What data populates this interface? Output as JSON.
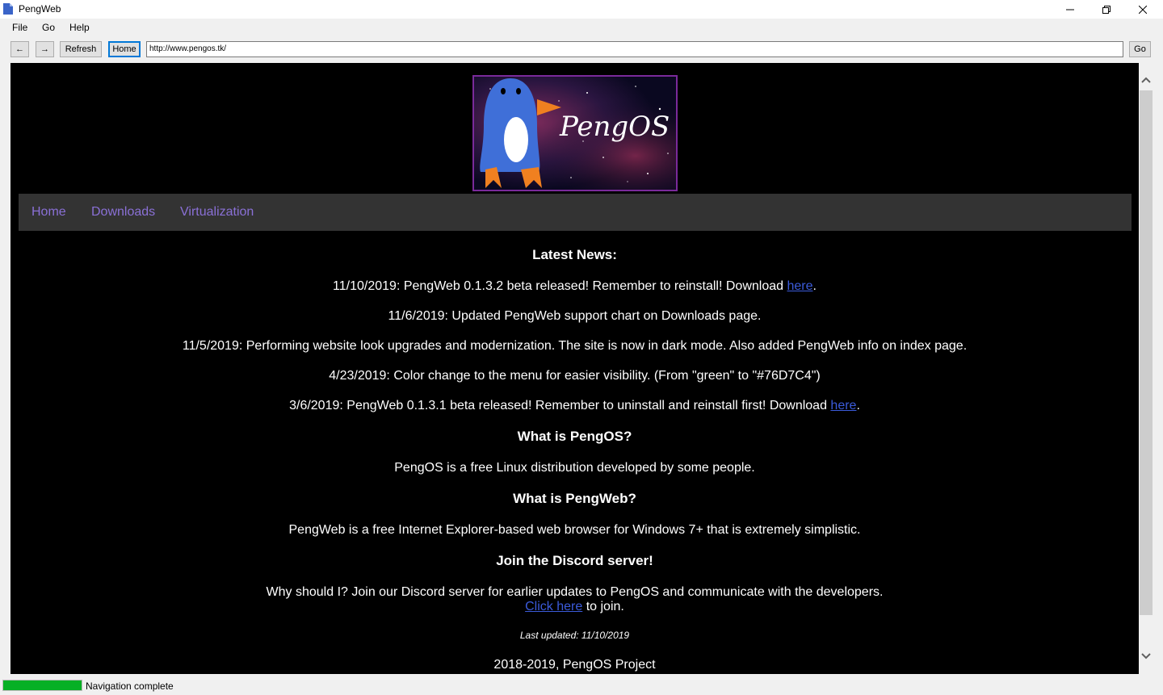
{
  "window": {
    "title": "PengWeb"
  },
  "menu": {
    "file": "File",
    "go": "Go",
    "help": "Help"
  },
  "toolbar": {
    "back_label": "←",
    "forward_label": "→",
    "refresh_label": "Refresh",
    "home_label": "Home",
    "address": "http://www.pengos.tk/",
    "go_label": "Go"
  },
  "logo": {
    "text": "PengOS"
  },
  "nav": {
    "home": "Home",
    "downloads": "Downloads",
    "virtualization": "Virtualization"
  },
  "colors": {
    "nav_link": "#8a70d6",
    "nav_bg": "#333333",
    "progress": "#06b025"
  },
  "news": {
    "heading": "Latest News:",
    "item1": "11/10/2019: PengWeb 0.1.3.2 beta released! Remember to reinstall! Download ",
    "item1_link": "here",
    "item2": "11/6/2019: Updated PengWeb support chart on Downloads page.",
    "item3": "11/5/2019: Performing website look upgrades and modernization. The site is now in dark mode. Also added PengWeb info on index page.",
    "item4": "4/23/2019: Color change to the menu for easier visibility. (From \"green\" to \"#76D7C4\")",
    "item5": "3/6/2019: PengWeb 0.1.3.1 beta released! Remember to uninstall and reinstall first! Download ",
    "item5_link": "here"
  },
  "pengos": {
    "heading": "What is PengOS?",
    "text": "PengOS is a free Linux distribution developed by some people."
  },
  "pengweb": {
    "heading": "What is PengWeb?",
    "text": "PengWeb is a free Internet Explorer-based web browser for Windows 7+ that is extremely simplistic."
  },
  "discord": {
    "heading": "Join the Discord server!",
    "text": "Why should I? Join our Discord server for earlier updates to PengOS and communicate with the developers.",
    "link": "Click here",
    "after_link": " to join."
  },
  "footer": {
    "updated": "Last updated: 11/10/2019",
    "copyright": "2018-2019, PengOS Project"
  },
  "status": {
    "text": "Navigation complete",
    "progress_percent": 100
  }
}
